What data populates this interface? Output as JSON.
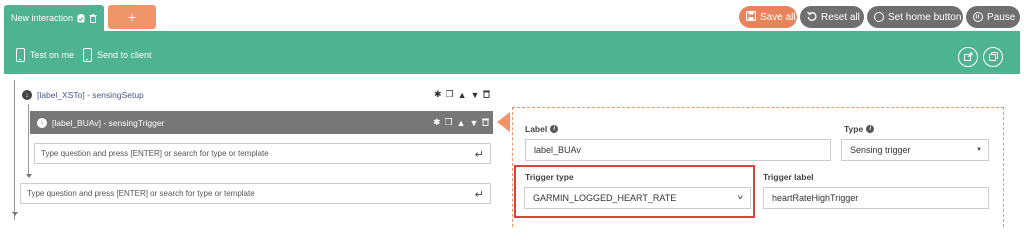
{
  "tabs": {
    "active_label": "New interaction",
    "add_label": "+"
  },
  "top_buttons": {
    "save": "Save all",
    "reset": "Reset all",
    "home": "Set home button",
    "pause": "Pause"
  },
  "toolbar": {
    "test_on_me": "Test on me",
    "send_to_client": "Send to client"
  },
  "tree": {
    "setup_label": "[label_XSTo] - sensingSetup",
    "trigger_label": "[label_BUAv] - sensingTrigger",
    "inner_input_placeholder": "Type question and press [ENTER] or search for type or template",
    "outer_input_placeholder": "Type question and press [ENTER] or search for type or template"
  },
  "panel": {
    "label_caption": "Label",
    "label_value": "label_BUAv",
    "type_caption": "Type",
    "type_value": "Sensing trigger",
    "trigger_type_caption": "Trigger type",
    "trigger_type_value": "GARMIN_LOGGED_HEART_RATE",
    "trigger_label_caption": "Trigger label",
    "trigger_label_value": "heartRateHighTrigger"
  },
  "colors": {
    "brand_green": "#4db391",
    "accent_orange": "#f0956a",
    "button_gray": "#6f6f6f",
    "highlight_red": "#d9453a"
  }
}
